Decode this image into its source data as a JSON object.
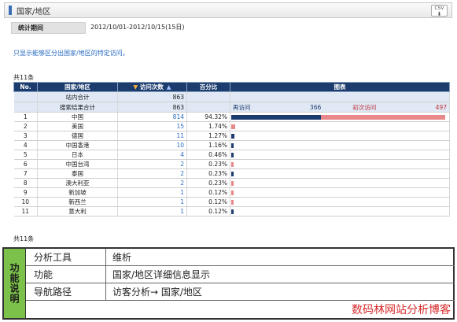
{
  "header": {
    "title": "国家/地区",
    "csv_label": "CSV",
    "csv_arrow": "⬇"
  },
  "period": {
    "label": "统计期间",
    "value": "2012/10/01-2012/10/15(15日)"
  },
  "note": "只显示能够区分出国家/地区的特定访问。",
  "total_text": "共11条",
  "table": {
    "headers": {
      "no": "No.",
      "country": "国家/地区",
      "visits": "访问次数",
      "percent": "百分比",
      "chart": "图表"
    },
    "summary": [
      {
        "label": "站内合计",
        "visits": "863"
      },
      {
        "label": "搜索结果合计",
        "visits": "863"
      }
    ],
    "legend": {
      "returning_label": "再访问",
      "returning_value": "366",
      "new_label": "初次访问",
      "new_value": "497"
    },
    "rows": [
      {
        "no": "1",
        "country": "中国",
        "visits": "814",
        "percent": "94.32%",
        "ret": 0.42,
        "new": 0.58
      },
      {
        "no": "2",
        "country": "美国",
        "visits": "15",
        "percent": "1.74%",
        "ret": 0.0,
        "new": 1.0
      },
      {
        "no": "3",
        "country": "德国",
        "visits": "11",
        "percent": "1.27%",
        "ret": 1.0,
        "new": 0.0
      },
      {
        "no": "4",
        "country": "中国香港",
        "visits": "10",
        "percent": "1.16%",
        "ret": 1.0,
        "new": 0.0
      },
      {
        "no": "5",
        "country": "日本",
        "visits": "4",
        "percent": "0.46%",
        "ret": 1.0,
        "new": 0.0
      },
      {
        "no": "6",
        "country": "中国台湾",
        "visits": "2",
        "percent": "0.23%",
        "ret": 0.0,
        "new": 1.0
      },
      {
        "no": "7",
        "country": "泰国",
        "visits": "2",
        "percent": "0.23%",
        "ret": 1.0,
        "new": 0.0
      },
      {
        "no": "8",
        "country": "澳大利亚",
        "visits": "2",
        "percent": "0.23%",
        "ret": 0.0,
        "new": 1.0
      },
      {
        "no": "9",
        "country": "新加坡",
        "visits": "1",
        "percent": "0.12%",
        "ret": 0.0,
        "new": 1.0
      },
      {
        "no": "10",
        "country": "新西兰",
        "visits": "1",
        "percent": "0.12%",
        "ret": 0.0,
        "new": 1.0
      },
      {
        "no": "11",
        "country": "意大利",
        "visits": "1",
        "percent": "0.12%",
        "ret": 1.0,
        "new": 0.0
      }
    ]
  },
  "info": {
    "side_label": "功能说明",
    "rows": [
      {
        "key": "分析工具",
        "value": "维析"
      },
      {
        "key": "功能",
        "value": "国家/地区详细信息显示"
      },
      {
        "key": "导航路径",
        "value": "访客分析→ 国家/地区"
      }
    ]
  },
  "watermark": "数码林网站分析博客",
  "colors": {
    "header_bg": "#1c3c6e",
    "returning": "#1c3c6e",
    "new": "#e88888",
    "side": "#7cc24a"
  }
}
